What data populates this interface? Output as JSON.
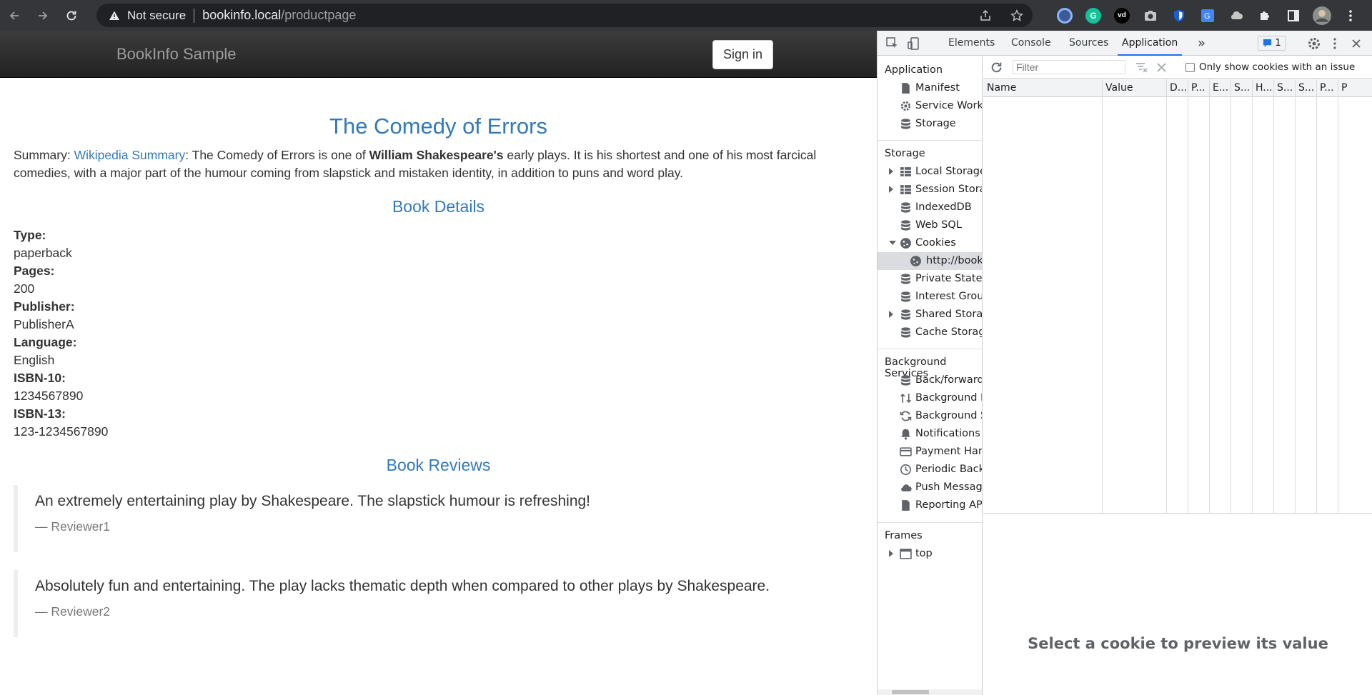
{
  "browser": {
    "security_label": "Not secure",
    "url_host": "bookinfo.local",
    "url_path": "/productpage"
  },
  "site": {
    "brand": "BookInfo Sample",
    "signin_label": "Sign in",
    "title": "The Comedy of Errors",
    "summary": {
      "prefix": "Summary: ",
      "link_text": "Wikipedia Summary",
      "text_before_bold": ": The Comedy of Errors is one of ",
      "bold_text": "William Shakespeare's",
      "text_after_bold": " early plays. It is his shortest and one of his most farcical comedies, with a major part of the humour coming from slapstick and mistaken identity, in addition to puns and word play."
    },
    "details_heading": "Book Details",
    "details": [
      {
        "label": "Type:",
        "value": "paperback"
      },
      {
        "label": "Pages:",
        "value": "200"
      },
      {
        "label": "Publisher:",
        "value": "PublisherA"
      },
      {
        "label": "Language:",
        "value": "English"
      },
      {
        "label": "ISBN-10:",
        "value": "1234567890"
      },
      {
        "label": "ISBN-13:",
        "value": "123-1234567890"
      }
    ],
    "reviews_heading": "Book Reviews",
    "reviews": [
      {
        "text": "An extremely entertaining play by Shakespeare. The slapstick humour is refreshing!",
        "author": "— Reviewer1"
      },
      {
        "text": "Absolutely fun and entertaining. The play lacks thematic depth when compared to other plays by Shakespeare.",
        "author": "— Reviewer2"
      }
    ]
  },
  "devtools": {
    "tabs": [
      "Elements",
      "Console",
      "Sources",
      "Application"
    ],
    "active_tab": "Application",
    "more_tabs": "»",
    "issues_count": "1",
    "sidebar": {
      "app_heading": "Application",
      "app_items": [
        "Manifest",
        "Service Workers",
        "Storage"
      ],
      "storage_heading": "Storage",
      "storage_items": [
        "Local Storage",
        "Session Storage",
        "IndexedDB",
        "Web SQL",
        "Cookies",
        "http://bookinfo.local",
        "Private State Tokens",
        "Interest Groups",
        "Shared Storage",
        "Cache Storage"
      ],
      "bg_heading": "Background Services",
      "bg_items": [
        "Back/forward cache",
        "Background Fetch",
        "Background Sync",
        "Notifications",
        "Payment Handler",
        "Periodic Background Sync",
        "Push Messaging",
        "Reporting API"
      ],
      "frames_heading": "Frames",
      "frames_items": [
        "top"
      ]
    },
    "cookies": {
      "filter_placeholder": "Filter",
      "only_issue_label": "Only show cookies with an issue",
      "columns": [
        "Name",
        "Value",
        "D...",
        "P...",
        "E...",
        "S...",
        "H...",
        "S...",
        "S...",
        "P...",
        "P"
      ],
      "preview_message": "Select a cookie to preview its value"
    }
  }
}
